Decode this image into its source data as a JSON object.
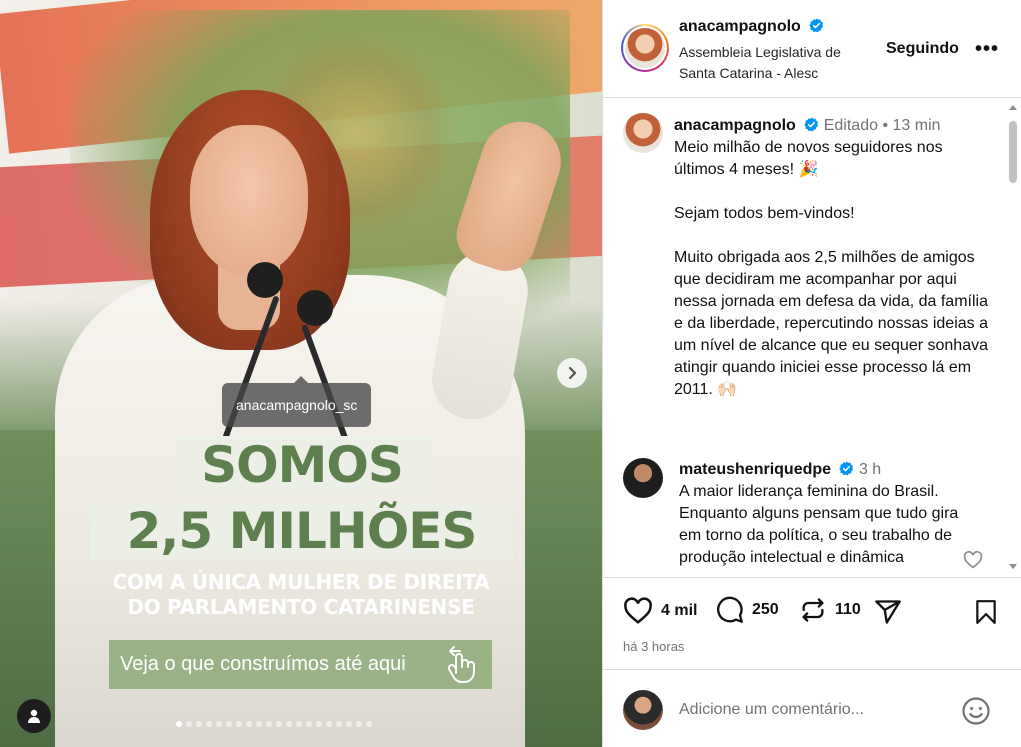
{
  "media": {
    "headline_line1": "SOMOS",
    "headline_line2": "2,5 MILHÕES",
    "subline1": "COM A ÚNICA MULHER DE DIREITA",
    "subline2": "DO PARLAMENTO CATARINENSE",
    "cta": "Veja o que construímos até aqui",
    "tag": "anacampagnolo_sc",
    "carousel_dots": 20,
    "active_dot": 0
  },
  "header": {
    "username": "anacampagnolo",
    "location_line1": "Assembleia Legislativa de",
    "location_line2": "Santa Catarina - Alesc",
    "follow_label": "Seguindo",
    "more_label": "•••"
  },
  "caption": {
    "username": "anacampagnolo",
    "edited": "Editado",
    "separator": "•",
    "time": "13 min",
    "line1": "Meio milhão de novos seguidores nos últimos 4 meses! 🎉",
    "line2": "Sejam todos bem-vindos!",
    "line3": "Muito obrigada aos 2,5 milhões de amigos que decidiram me acompanhar por aqui nessa jornada em defesa da vida, da família e da liberdade, repercutindo nossas ideias a um nível de alcance que eu sequer sonhava atingir quando iniciei esse processo lá em 2011. 🙌🏻"
  },
  "comment": {
    "username": "mateushenriquedpe",
    "time": "3 h",
    "text": "A maior liderança feminina do Brasil. Enquanto alguns pensam que tudo gira em torno da política, o seu trabalho de produção intelectual e dinâmica"
  },
  "actions": {
    "likes": "4 mil",
    "comments": "250",
    "reposts": "110",
    "ago": "há 3 horas"
  },
  "add_comment": {
    "placeholder": "Adicione um comentário..."
  },
  "colors": {
    "verified": "#0095f6",
    "headline_green": "#5e7f4e",
    "muted": "#737373",
    "divider": "#dbdbdb"
  }
}
